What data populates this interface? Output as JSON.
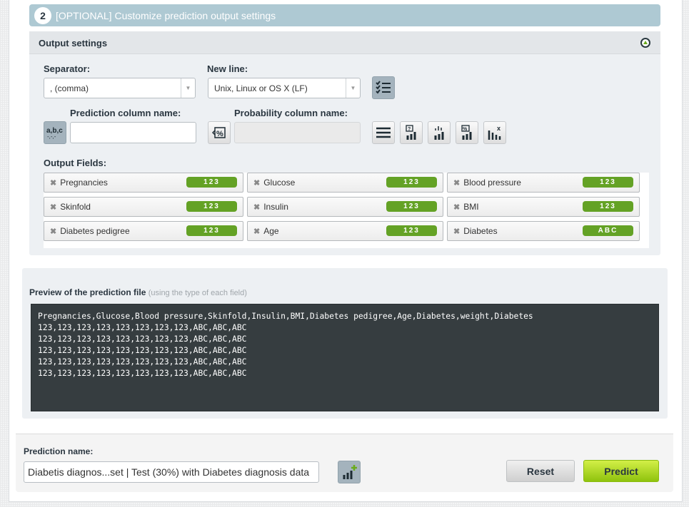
{
  "step": {
    "number": "2",
    "title": "[OPTIONAL] Customize prediction output settings"
  },
  "output_settings": {
    "title": "Output settings",
    "separator_label": "Separator:",
    "separator_value": ", (comma)",
    "newline_label": "New line:",
    "newline_value": "Unix, Linux or OS X (LF)",
    "prediction_column_label": "Prediction column name:",
    "prediction_column_value": "",
    "probability_column_label": "Probability column name:",
    "probability_column_value": "",
    "output_fields_label": "Output Fields:",
    "fields": [
      {
        "name": "Pregnancies",
        "type": "123"
      },
      {
        "name": "Glucose",
        "type": "123"
      },
      {
        "name": "Blood pressure",
        "type": "123"
      },
      {
        "name": "Skinfold",
        "type": "123"
      },
      {
        "name": "Insulin",
        "type": "123"
      },
      {
        "name": "BMI",
        "type": "123"
      },
      {
        "name": "Diabetes pedigree",
        "type": "123"
      },
      {
        "name": "Age",
        "type": "123"
      },
      {
        "name": "Diabetes",
        "type": "ABC"
      }
    ],
    "icons": [
      "checklist-icon",
      "text-format-icon",
      "percent-icon",
      "list-icon",
      "confidence-chart-icon",
      "distribution-chart-icon",
      "probability-chart-icon",
      "exclude-chart-icon"
    ]
  },
  "preview": {
    "title": "Preview of the prediction file",
    "subtitle": "(using the type of each field)",
    "lines": [
      "Pregnancies,Glucose,Blood pressure,Skinfold,Insulin,BMI,Diabetes pedigree,Age,Diabetes,weight,Diabetes",
      "123,123,123,123,123,123,123,123,ABC,ABC,ABC",
      "123,123,123,123,123,123,123,123,ABC,ABC,ABC",
      "123,123,123,123,123,123,123,123,ABC,ABC,ABC",
      "123,123,123,123,123,123,123,123,ABC,ABC,ABC",
      "123,123,123,123,123,123,123,123,ABC,ABC,ABC"
    ]
  },
  "bottom": {
    "prediction_name_label": "Prediction name:",
    "prediction_name_value": "Diabetis diagnos...set | Test (30%) with Diabetes diagnosis data",
    "reset_label": "Reset",
    "predict_label": "Predict"
  },
  "colors": {
    "accent_green": "#64a225",
    "step_header": "#aec9d3",
    "predict_button": "#9fd116"
  }
}
